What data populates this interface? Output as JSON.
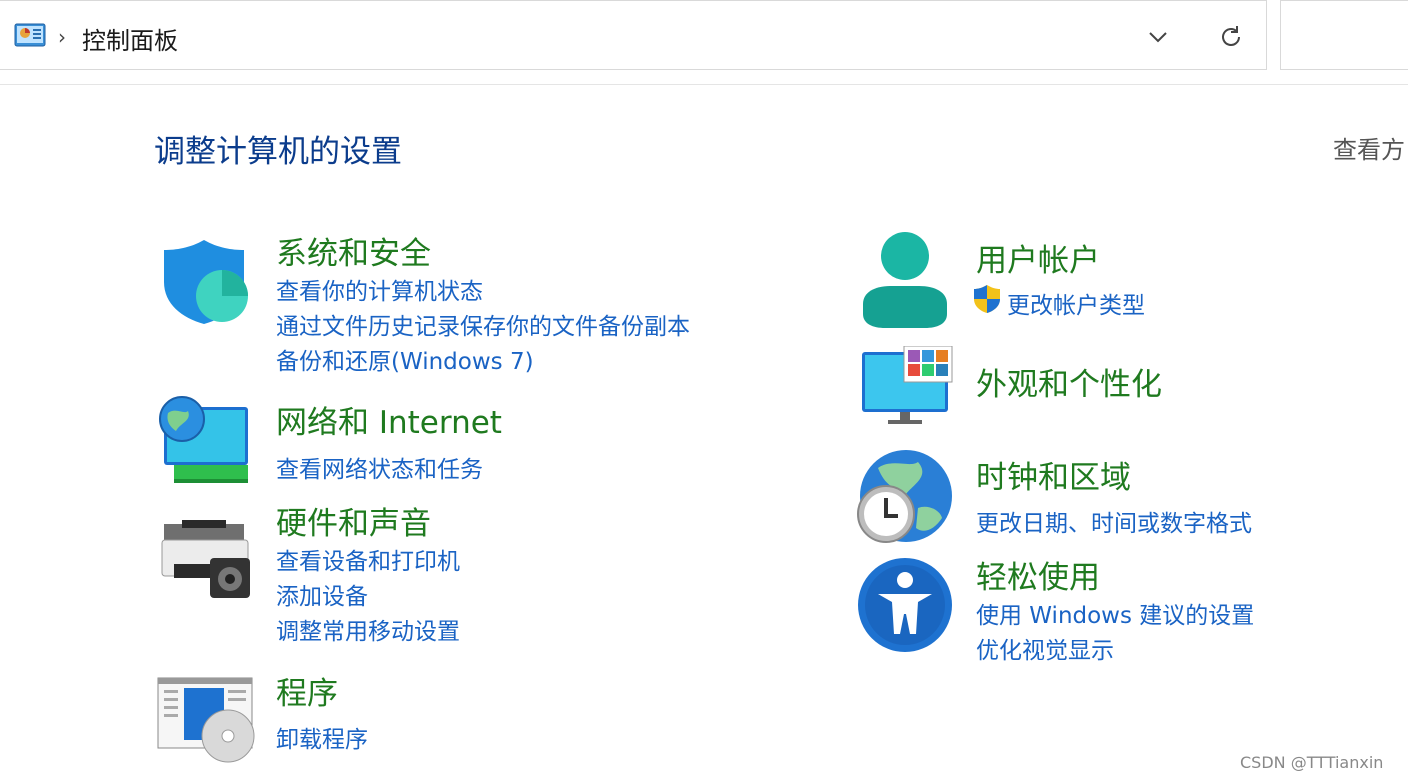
{
  "address_bar": {
    "crumb": "控制面板"
  },
  "page_title": "调整计算机的设置",
  "view_by": "查看方",
  "categories": {
    "security": {
      "title": "系统和安全",
      "links": [
        "查看你的计算机状态",
        "通过文件历史记录保存你的文件备份副本",
        "备份和还原(Windows 7)"
      ]
    },
    "network": {
      "title": "网络和 Internet",
      "links": [
        "查看网络状态和任务"
      ]
    },
    "hardware": {
      "title": "硬件和声音",
      "links": [
        "查看设备和打印机",
        "添加设备",
        "调整常用移动设置"
      ]
    },
    "programs": {
      "title": "程序",
      "links": [
        "卸载程序"
      ]
    },
    "users": {
      "title": "用户帐户",
      "links": [
        "更改帐户类型"
      ]
    },
    "appearance": {
      "title": "外观和个性化",
      "links": []
    },
    "clock": {
      "title": "时钟和区域",
      "links": [
        "更改日期、时间或数字格式"
      ]
    },
    "ease": {
      "title": "轻松使用",
      "links": [
        "使用 Windows 建议的设置",
        "优化视觉显示"
      ]
    }
  },
  "watermark": "CSDN @TTTianxin",
  "colors": {
    "category_title": "#1f7a1f",
    "link": "#1a63c4",
    "page_title": "#0b3c8c"
  }
}
